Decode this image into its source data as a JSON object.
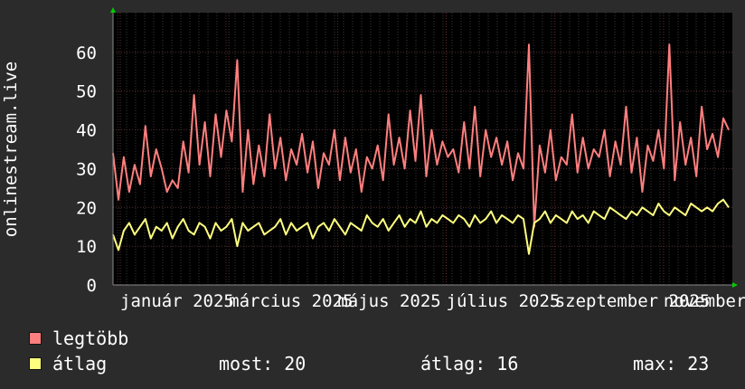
{
  "chart_data": {
    "type": "line",
    "ylabel": "onlinestream.live",
    "ylim": [
      0,
      70
    ],
    "yticks": [
      0,
      10,
      20,
      30,
      40,
      50,
      60
    ],
    "grid": true,
    "x_tick_labels": [
      "január 2025",
      "március 2025",
      "május 2025",
      "július 2025",
      "szeptember 2025",
      "november 2025"
    ],
    "series": [
      {
        "name": "legtöbb",
        "color": "#ff7f7f",
        "values": [
          34,
          22,
          33,
          24,
          31,
          26,
          41,
          28,
          35,
          30,
          24,
          27,
          25,
          37,
          29,
          49,
          31,
          42,
          28,
          44,
          33,
          45,
          37,
          58,
          24,
          40,
          26,
          36,
          28,
          44,
          30,
          38,
          27,
          35,
          31,
          39,
          29,
          37,
          25,
          34,
          31,
          40,
          27,
          38,
          29,
          35,
          24,
          33,
          30,
          36,
          27,
          44,
          31,
          38,
          30,
          45,
          32,
          49,
          28,
          40,
          31,
          37,
          33,
          35,
          29,
          42,
          30,
          46,
          28,
          40,
          33,
          38,
          31,
          37,
          27,
          34,
          30,
          62,
          15,
          36,
          29,
          40,
          27,
          33,
          31,
          44,
          29,
          38,
          30,
          35,
          33,
          40,
          28,
          37,
          31,
          46,
          29,
          38,
          24,
          36,
          32,
          40,
          30,
          62,
          27,
          42,
          31,
          38,
          28,
          46,
          35,
          39,
          33,
          43,
          40
        ],
        "max": 63
      },
      {
        "name": "átlag",
        "color": "#ffff7f",
        "values": [
          13,
          9,
          14,
          16,
          13,
          15,
          17,
          12,
          15,
          14,
          16,
          12,
          15,
          17,
          14,
          13,
          16,
          15,
          12,
          16,
          14,
          15,
          17,
          10,
          16,
          14,
          15,
          16,
          13,
          14,
          15,
          17,
          13,
          16,
          14,
          15,
          16,
          12,
          15,
          16,
          14,
          17,
          15,
          13,
          16,
          15,
          14,
          18,
          16,
          15,
          17,
          14,
          16,
          18,
          15,
          17,
          16,
          19,
          15,
          17,
          16,
          18,
          17,
          16,
          18,
          17,
          15,
          18,
          16,
          17,
          19,
          16,
          18,
          17,
          16,
          18,
          17,
          8,
          16,
          17,
          19,
          16,
          18,
          17,
          16,
          19,
          17,
          18,
          16,
          19,
          18,
          17,
          20,
          19,
          18,
          17,
          19,
          18,
          20,
          19,
          18,
          21,
          19,
          18,
          20,
          19,
          18,
          21,
          20,
          19,
          20,
          19,
          21,
          22,
          20
        ],
        "now": 20,
        "avg": 16,
        "max": 23
      }
    ]
  },
  "legend": {
    "series1_label": "legtöbb",
    "series2_label": "átlag",
    "now_text": "most: 20",
    "avg_text": "átlag: 16",
    "max_text": "max: 23"
  }
}
